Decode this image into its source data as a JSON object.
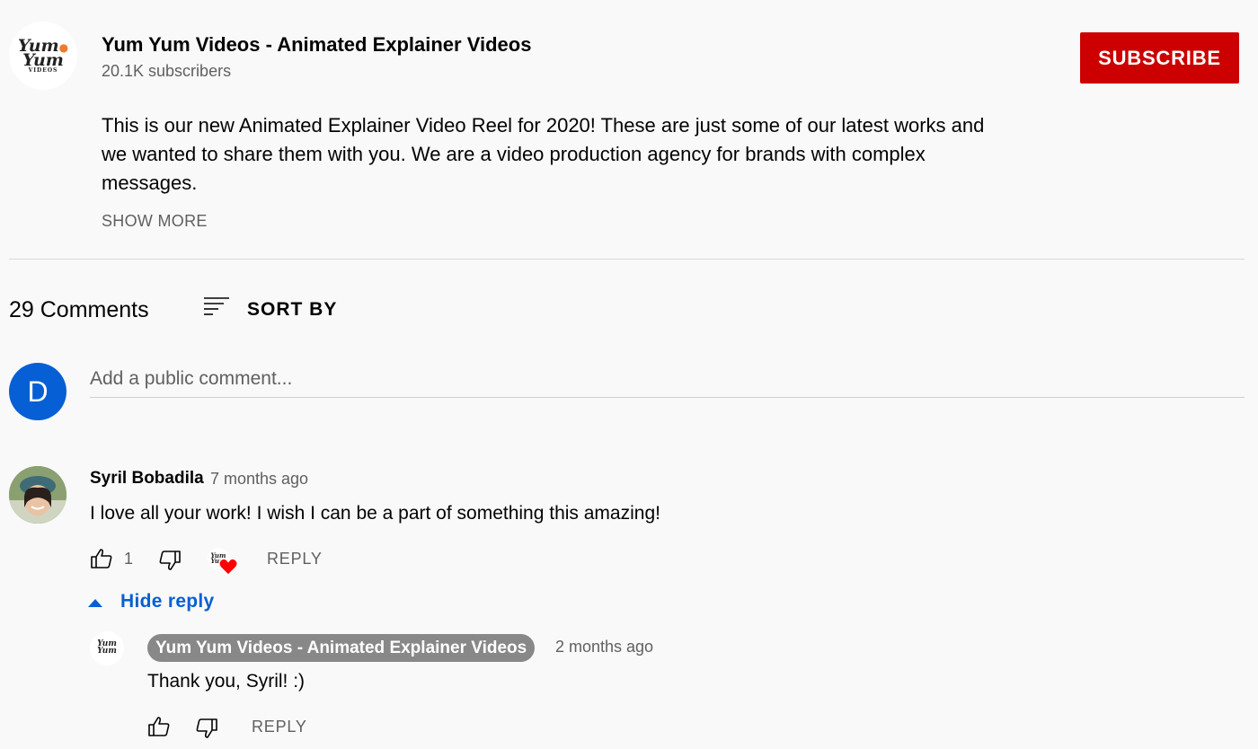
{
  "channel": {
    "name": "Yum Yum Videos - Animated Explainer Videos",
    "subscribers": "20.1K subscribers",
    "logo_line1": "Yum",
    "logo_line2": "Yum",
    "logo_small": "VIDEOS",
    "subscribe_label": "SUBSCRIBE"
  },
  "description": {
    "text": "This is our new Animated Explainer Video Reel for 2020! These are just some of our latest works and we wanted to share them with you. We are a video production agency for brands with complex messages.",
    "show_more": "SHOW MORE"
  },
  "comments_header": {
    "count": "29 Comments",
    "sort_label": "SORT BY"
  },
  "add_comment": {
    "avatar_letter": "D",
    "placeholder": "Add a public comment..."
  },
  "comment": {
    "author": "Syril Bobadila",
    "time": "7 months ago",
    "text": "I love all your work! I wish I can be a part of something this amazing!",
    "likes": "1",
    "reply_label": "REPLY",
    "hide_reply_label": "Hide reply"
  },
  "reply": {
    "author": "Yum Yum Videos - Animated Explainer Videos",
    "time": "2 months ago",
    "text": "Thank you, Syril! :)",
    "reply_label": "REPLY"
  },
  "colors": {
    "subscribe": "#cc0000",
    "link_blue": "#065fd4",
    "heart": "#ff0000",
    "author_badge": "#888888"
  }
}
